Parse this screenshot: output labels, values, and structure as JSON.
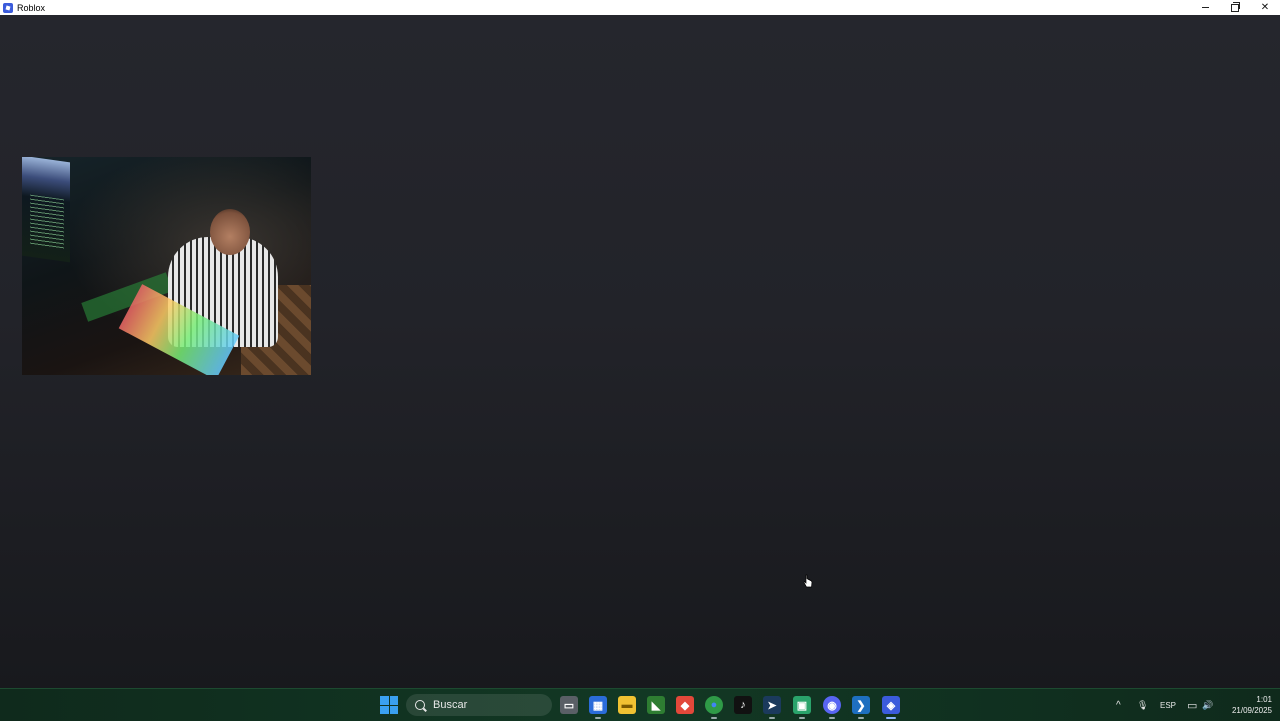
{
  "window": {
    "title": "Roblox",
    "controls": {
      "minimize": "minimize",
      "restore": "restore",
      "close": "✕"
    }
  },
  "taskbar": {
    "search_placeholder": "Buscar",
    "apps": [
      {
        "name": "task-view",
        "glyph": "▭",
        "color": "#5a5f66"
      },
      {
        "name": "microsoft-store",
        "glyph": "▦",
        "color": "#2b6cd9"
      },
      {
        "name": "file-explorer",
        "glyph": "▬",
        "color": "#f1c232"
      },
      {
        "name": "nvidia",
        "glyph": "◣",
        "color": "#2e7d32"
      },
      {
        "name": "brave",
        "glyph": "◆",
        "color": "#e2483a"
      },
      {
        "name": "chrome",
        "glyph": "●",
        "color": "#2f9a47"
      },
      {
        "name": "tiktok",
        "glyph": "♪",
        "color": "#111111"
      },
      {
        "name": "steam",
        "glyph": "➤",
        "color": "#1b3a5c"
      },
      {
        "name": "android",
        "glyph": "▣",
        "color": "#2aa36b"
      },
      {
        "name": "discord",
        "glyph": "◉",
        "color": "#5865f2"
      },
      {
        "name": "vscode",
        "glyph": "❯",
        "color": "#1e6fc0"
      },
      {
        "name": "roblox",
        "glyph": "◈",
        "color": "#3b5bdb"
      }
    ],
    "tray": {
      "chevron": "^",
      "mic": "🎙",
      "language": "ESP",
      "network": "▭",
      "volume": "🔊",
      "time": "1:01",
      "date": "21/09/2025"
    }
  }
}
